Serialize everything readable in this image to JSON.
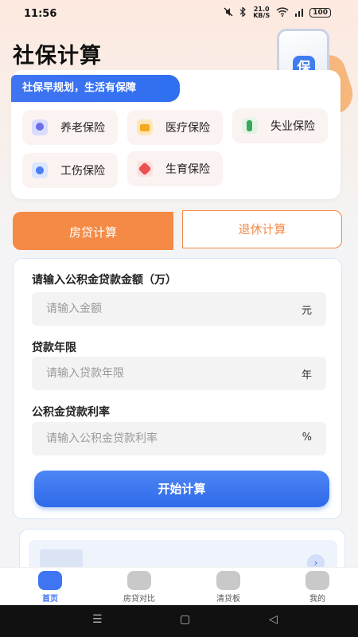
{
  "status_bar": {
    "time": "11:56",
    "net_speed": "21.0",
    "net_unit": "KB/S",
    "battery": "100"
  },
  "header": {
    "title": "社保计算",
    "badge_glyph": "保"
  },
  "insurance": {
    "banner": "社保早规划，生活有保障",
    "items": [
      {
        "label": "养老保险",
        "icon": "pension-icon"
      },
      {
        "label": "医疗保险",
        "icon": "medical-icon"
      },
      {
        "label": "失业保险",
        "icon": "unemployment-icon"
      },
      {
        "label": "工伤保险",
        "icon": "injury-icon"
      },
      {
        "label": "生育保险",
        "icon": "maternity-icon"
      }
    ]
  },
  "tabs": {
    "active": "房贷计算",
    "inactive": "退休计算"
  },
  "form": {
    "amount_label": "请输入公积金贷款金额（万）",
    "amount_placeholder": "请输入金额",
    "amount_unit": "元",
    "years_label": "贷款年限",
    "years_placeholder": "请输入贷款年限",
    "years_unit": "年",
    "rate_label": "公积金贷款利率",
    "rate_placeholder": "请输入公积金贷款利率",
    "rate_unit": "%",
    "button": "开始计算"
  },
  "nav": {
    "items": [
      {
        "label": "首页",
        "icon": "home-icon",
        "active": true
      },
      {
        "label": "房贷对比",
        "icon": "compare-icon",
        "active": false
      },
      {
        "label": "清贷板",
        "icon": "money-bag-icon",
        "active": false
      },
      {
        "label": "我的",
        "icon": "profile-icon",
        "active": false
      }
    ]
  },
  "system_nav": {
    "menu": "☰",
    "home": "▢",
    "back": "◁"
  },
  "colors": {
    "accent_orange": "#f48a46",
    "accent_blue": "#3f74f2"
  }
}
